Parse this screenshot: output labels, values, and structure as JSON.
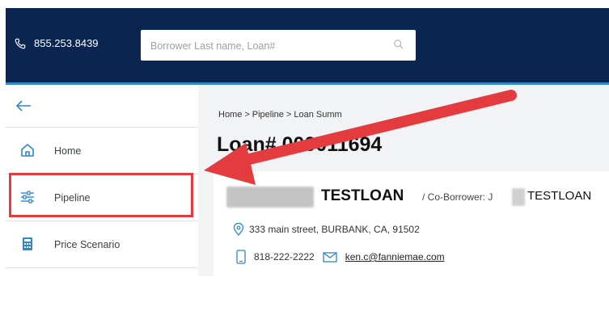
{
  "header": {
    "phone": "855.253.8439",
    "search": {
      "placeholder": "Borrower Last name, Loan#"
    }
  },
  "sidebar": {
    "items": [
      {
        "label": "Home",
        "icon": "home-icon"
      },
      {
        "label": "Pipeline",
        "icon": "sliders-icon"
      },
      {
        "label": "Price Scenario",
        "icon": "calculator-icon"
      }
    ]
  },
  "main": {
    "breadcrumb": [
      "Home",
      "Pipeline",
      "Loan Summ"
    ],
    "title": "Loan# 000011694",
    "borrower": {
      "last_name": "TESTLOAN"
    },
    "coborrower": {
      "label": "/ Co-Borrower: ",
      "prefix": "J",
      "last_name": "TESTLOAN"
    },
    "address": "333 main street, BURBANK, CA, 91502",
    "phone": "818-222-2222",
    "email": "ken.c@fanniemae.com"
  },
  "annotation": {
    "color": "#e43b3f"
  },
  "colors": {
    "header_bg": "#0b2551",
    "accent": "#2f86c9"
  }
}
